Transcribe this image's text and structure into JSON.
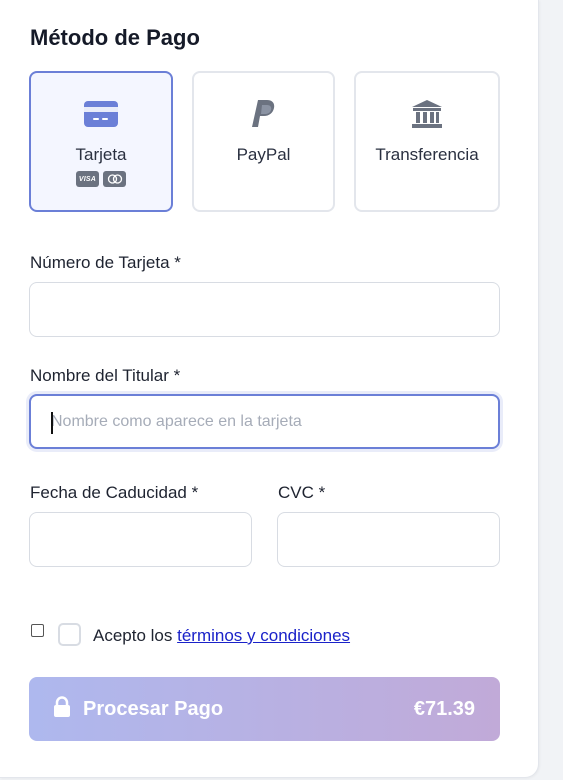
{
  "payment": {
    "title": "Método de Pago",
    "methods": [
      {
        "label": "Tarjeta",
        "icon": "credit-card-icon",
        "selected": true,
        "brands": [
          "VISA",
          "mastercard"
        ]
      },
      {
        "label": "PayPal",
        "icon": "paypal-icon",
        "selected": false
      },
      {
        "label": "Transferencia",
        "icon": "bank-icon",
        "selected": false
      }
    ]
  },
  "form": {
    "card_number": {
      "label": "Número de Tarjeta *",
      "value": "",
      "placeholder": ""
    },
    "holder_name": {
      "label": "Nombre del Titular *",
      "value": "",
      "placeholder": "Nombre como aparece en la tarjeta"
    },
    "expiry": {
      "label": "Fecha de Caducidad *",
      "value": "",
      "placeholder": ""
    },
    "cvc": {
      "label": "CVC *",
      "value": "",
      "placeholder": ""
    }
  },
  "terms": {
    "prefix": "Acepto los ",
    "link": "términos y condiciones",
    "checked": false
  },
  "submit": {
    "label": "Procesar Pago",
    "amount": "€71.39",
    "icon": "lock-icon"
  },
  "colors": {
    "accent": "#6b7fd7",
    "button_start": "#aeb8ee",
    "button_end": "#c1aad8",
    "link": "#1a22c9"
  }
}
